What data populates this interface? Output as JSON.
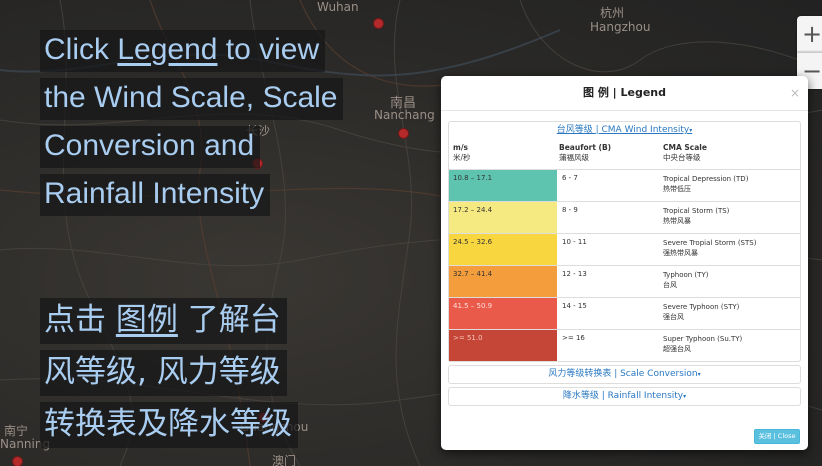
{
  "map": {
    "cities": [
      {
        "name": "Wuhan"
      },
      {
        "name": "杭州"
      },
      {
        "name": "Hangzhou"
      },
      {
        "name": "南昌"
      },
      {
        "name": "Nanchang"
      },
      {
        "name": "长沙"
      },
      {
        "name": "Guangzhou"
      },
      {
        "name": "南宁"
      },
      {
        "name": "Nanning"
      },
      {
        "name": "澳门"
      }
    ],
    "zoom_in": "+",
    "zoom_out": "−"
  },
  "overlay_en": {
    "line1_pre": "Click ",
    "line1_link": "Legend",
    "line1_post": " to view",
    "line2": "the Wind Scale, Scale",
    "line3": "Conversion and",
    "line4": "Rainfall Intensity"
  },
  "overlay_zh": {
    "line1_pre": "点击 ",
    "line1_link": "图例",
    "line1_post": " 了解台",
    "line2": "风等级, 风力等级",
    "line3": "转换表及降水等级"
  },
  "modal": {
    "title": "图 例 | Legend",
    "close_x": "×",
    "wind_panel_title": "台风等级 | CMA Wind Intensity",
    "columns": [
      {
        "en": "m/s",
        "zh": "米/秒"
      },
      {
        "en": "Beaufort (B)",
        "zh": "蒲福风级"
      },
      {
        "en": "CMA Scale",
        "zh": "中央台等级"
      }
    ],
    "rows": [
      {
        "speed": "10.8 – 17.1",
        "beaufort": "6 - 7",
        "en": "Tropical Depression (TD)",
        "zh": "热带低压",
        "color": "#5ec4b0",
        "text_color": "#333333"
      },
      {
        "speed": "17.2 – 24.4",
        "beaufort": "8 - 9",
        "en": "Tropical Storm (TS)",
        "zh": "热带风暴",
        "color": "#f5ea82",
        "text_color": "#333333"
      },
      {
        "speed": "24.5 – 32.6",
        "beaufort": "10 - 11",
        "en": "Severe Tropial Storm (STS)",
        "zh": "强热带风暴",
        "color": "#f7d640",
        "text_color": "#333333"
      },
      {
        "speed": "32.7 – 41.4",
        "beaufort": "12 - 13",
        "en": "Typhoon (TY)",
        "zh": "台风",
        "color": "#f39d3c",
        "text_color": "#333333"
      },
      {
        "speed": "41.5 – 50.9",
        "beaufort": "14 - 15",
        "en": "Severe Typhoon (STY)",
        "zh": "强台风",
        "color": "#ea5a4a",
        "text_color": "#ffe1dc"
      },
      {
        "speed": ">= 51.0",
        "beaufort": ">= 16",
        "en": "Super Typhoon (Su.TY)",
        "zh": "超强台风",
        "color": "#c54636",
        "text_color": "#f6c6bd"
      }
    ],
    "scale_panel_title": "风力等级转换表 | Scale Conversion",
    "rain_panel_title": "降水等级 | Rainfall Intensity",
    "close_button": "关闭 | Close"
  }
}
